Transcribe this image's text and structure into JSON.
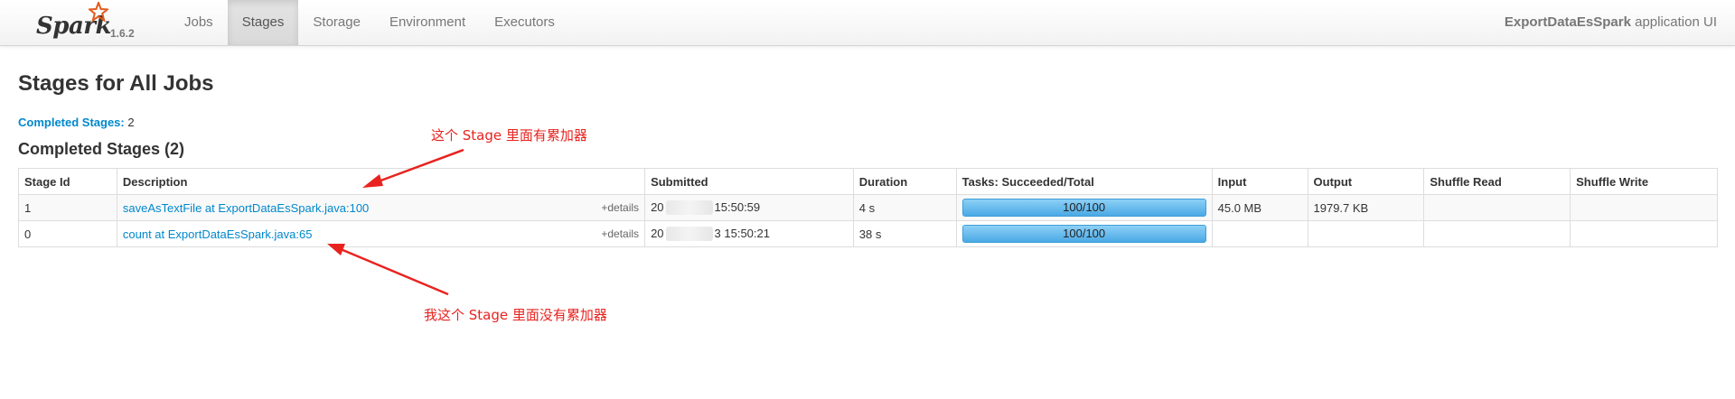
{
  "navbar": {
    "brand": "Spark",
    "version": "1.6.2",
    "tabs": [
      {
        "label": "Jobs",
        "active": false
      },
      {
        "label": "Stages",
        "active": true
      },
      {
        "label": "Storage",
        "active": false
      },
      {
        "label": "Environment",
        "active": false
      },
      {
        "label": "Executors",
        "active": false
      }
    ],
    "app_name": "ExportDataEsSpark",
    "app_suffix": " application UI"
  },
  "page_title": "Stages for All Jobs",
  "summary": {
    "label": "Completed Stages:",
    "count": "2"
  },
  "section_title": "Completed Stages (2)",
  "table": {
    "headers": [
      "Stage Id",
      "Description",
      "Submitted",
      "Duration",
      "Tasks: Succeeded/Total",
      "Input",
      "Output",
      "Shuffle Read",
      "Shuffle Write"
    ],
    "rows": [
      {
        "stage_id": "1",
        "description": "saveAsTextFile at ExportDataEsSpark.java:100",
        "details": "+details",
        "submitted_prefix": "20",
        "submitted_suffix": "15:50:59",
        "duration": "4 s",
        "tasks": "100/100",
        "progress": 1.0,
        "input": "45.0 MB",
        "output": "1979.7 KB",
        "shuffle_read": "",
        "shuffle_write": ""
      },
      {
        "stage_id": "0",
        "description": "count at ExportDataEsSpark.java:65",
        "details": "+details",
        "submitted_prefix": "20",
        "submitted_suffix": "3 15:50:21",
        "duration": "38 s",
        "tasks": "100/100",
        "progress": 1.0,
        "input": "",
        "output": "",
        "shuffle_read": "",
        "shuffle_write": ""
      }
    ]
  },
  "annotations": {
    "top": "这个 Stage 里面有累加器",
    "bottom": "我这个 Stage 里面没有累加器",
    "color": "#e8231f"
  },
  "colors": {
    "link": "#0088cc",
    "progress": "#5bb6ea"
  }
}
